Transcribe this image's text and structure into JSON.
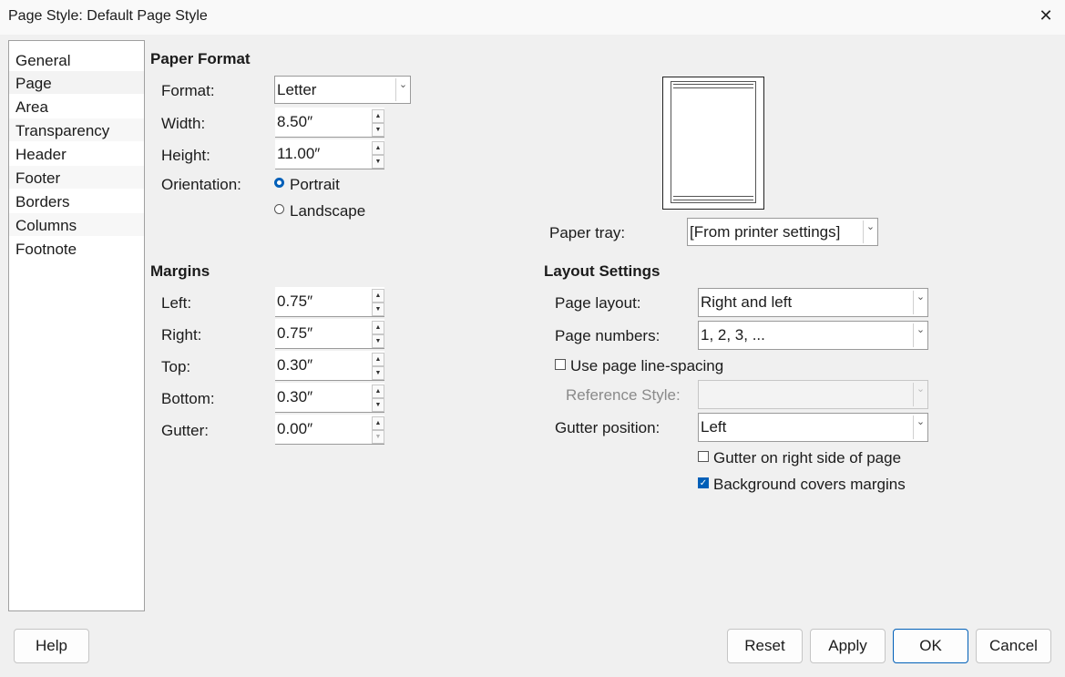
{
  "window": {
    "title": "Page Style: Default Page Style",
    "close_glyph": "✕"
  },
  "sidebar": {
    "items": [
      {
        "label": "General"
      },
      {
        "label": "Page"
      },
      {
        "label": "Area"
      },
      {
        "label": "Transparency"
      },
      {
        "label": "Header"
      },
      {
        "label": "Footer"
      },
      {
        "label": "Borders"
      },
      {
        "label": "Columns"
      },
      {
        "label": "Footnote"
      }
    ],
    "selected": "Page"
  },
  "paper_format": {
    "heading": "Paper Format",
    "format_label": "Format:",
    "format_value": "Letter",
    "width_label": "Width:",
    "width_value": "8.50″",
    "height_label": "Height:",
    "height_value": "11.00″",
    "orientation_label": "Orientation:",
    "portrait_label": "Portrait",
    "landscape_label": "Landscape",
    "orientation_selected": "Portrait",
    "paper_tray_label": "Paper tray:",
    "paper_tray_value": "[From printer settings]"
  },
  "margins": {
    "heading": "Margins",
    "left_label": "Left:",
    "left_value": "0.75″",
    "right_label": "Right:",
    "right_value": "0.75″",
    "top_label": "Top:",
    "top_value": "0.30″",
    "bottom_label": "Bottom:",
    "bottom_value": "0.30″",
    "gutter_label": "Gutter:",
    "gutter_value": "0.00″"
  },
  "layout": {
    "heading": "Layout Settings",
    "page_layout_label": "Page layout:",
    "page_layout_value": "Right and left",
    "page_numbers_label": "Page numbers:",
    "page_numbers_value": "1, 2, 3, ...",
    "use_line_spacing_label": "Use page line-spacing",
    "use_line_spacing_checked": false,
    "reference_style_label": "Reference Style:",
    "reference_style_value": "",
    "gutter_position_label": "Gutter position:",
    "gutter_position_value": "Left",
    "gutter_right_label": "Gutter on right side of page",
    "gutter_right_checked": false,
    "background_covers_label": "Background covers margins",
    "background_covers_checked": true
  },
  "buttons": {
    "help": "Help",
    "reset": "Reset",
    "apply": "Apply",
    "ok": "OK",
    "cancel": "Cancel"
  },
  "colors": {
    "accent": "#005fb8",
    "dialog_bg": "#f0f0f0"
  },
  "glyphs": {
    "dropdown": "⌄",
    "spin_up": "▲",
    "spin_down": "▼",
    "check": "✓"
  }
}
